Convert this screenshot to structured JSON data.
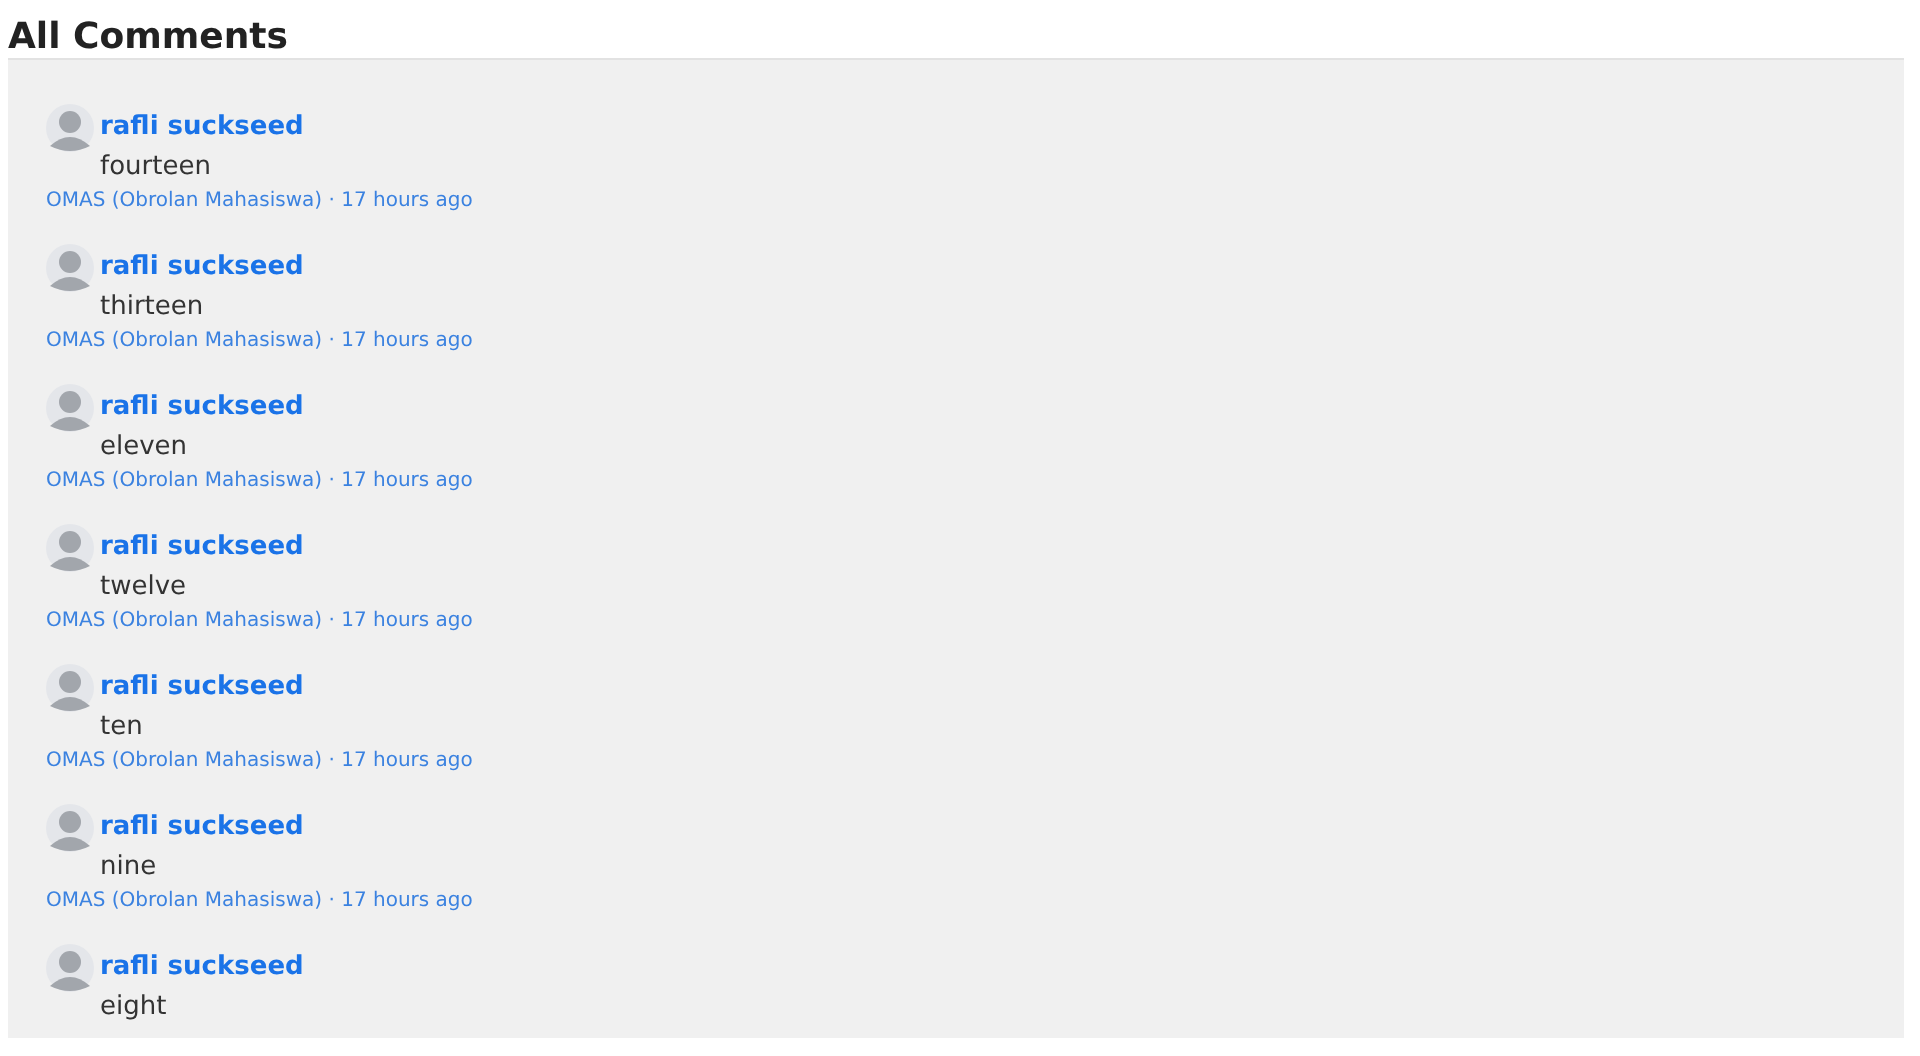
{
  "title": "All Comments",
  "comments": [
    {
      "author": "rafli suckseed",
      "text": "fourteen",
      "meta": "OMAS (Obrolan Mahasiswa) · 17 hours ago"
    },
    {
      "author": "rafli suckseed",
      "text": "thirteen",
      "meta": "OMAS (Obrolan Mahasiswa) · 17 hours ago"
    },
    {
      "author": "rafli suckseed",
      "text": "eleven",
      "meta": "OMAS (Obrolan Mahasiswa) · 17 hours ago"
    },
    {
      "author": "rafli suckseed",
      "text": "twelve",
      "meta": "OMAS (Obrolan Mahasiswa) · 17 hours ago"
    },
    {
      "author": "rafli suckseed",
      "text": "ten",
      "meta": "OMAS (Obrolan Mahasiswa) · 17 hours ago"
    },
    {
      "author": "rafli suckseed",
      "text": "nine",
      "meta": "OMAS (Obrolan Mahasiswa) · 17 hours ago"
    },
    {
      "author": "rafli suckseed",
      "text": "eight"
    }
  ]
}
